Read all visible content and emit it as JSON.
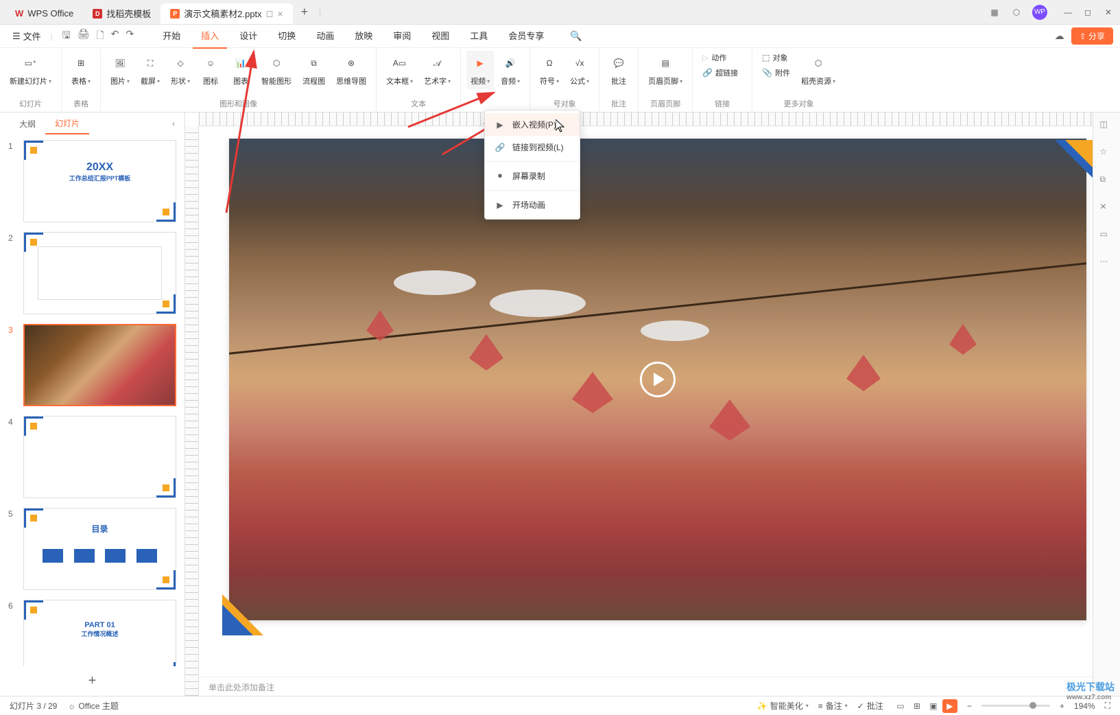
{
  "titlebar": {
    "app_name": "WPS Office",
    "tabs": [
      {
        "icon": "D",
        "label": "找稻壳模板"
      },
      {
        "icon": "P",
        "label": "演示文稿素材2.pptx"
      }
    ]
  },
  "menubar": {
    "file_label": "文件",
    "tabs": [
      "开始",
      "插入",
      "设计",
      "切换",
      "动画",
      "放映",
      "审阅",
      "视图",
      "工具",
      "会员专享"
    ],
    "active_tab": "插入",
    "share_label": "分享"
  },
  "ribbon": {
    "groups": [
      {
        "label": "幻灯片",
        "items": [
          {
            "label": "新建幻灯片",
            "caret": true
          }
        ]
      },
      {
        "label": "表格",
        "items": [
          {
            "label": "表格",
            "caret": true
          }
        ]
      },
      {
        "label": "图形和图像",
        "items": [
          {
            "label": "图片",
            "caret": true
          },
          {
            "label": "截屏",
            "caret": true
          },
          {
            "label": "形状",
            "caret": true
          },
          {
            "label": "图标"
          },
          {
            "label": "图表"
          },
          {
            "label": "智能图形"
          },
          {
            "label": "流程图"
          },
          {
            "label": "思维导图"
          }
        ]
      },
      {
        "label": "文本",
        "items": [
          {
            "label": "文本框",
            "caret": true
          },
          {
            "label": "艺术字",
            "caret": true
          }
        ]
      },
      {
        "label": "",
        "items": [
          {
            "label": "视频",
            "caret": true
          },
          {
            "label": "音频",
            "caret": true
          }
        ]
      },
      {
        "label": "号对象",
        "items": [
          {
            "label": "符号",
            "caret": true,
            "disabled": true
          },
          {
            "label": "公式",
            "caret": true
          }
        ]
      },
      {
        "label": "批注",
        "items": [
          {
            "label": "批注"
          }
        ]
      },
      {
        "label": "页眉页脚",
        "items": [
          {
            "label": "页眉页脚",
            "caret": true
          }
        ]
      },
      {
        "label": "链接",
        "items": [
          {
            "label": "动作",
            "disabled": true
          },
          {
            "label": "超链接",
            "disabled": true
          }
        ]
      },
      {
        "label": "更多对象",
        "items": [
          {
            "label": "对象"
          },
          {
            "label": "附件"
          },
          {
            "label": "稻壳资源",
            "caret": true
          }
        ]
      }
    ]
  },
  "slide_panel": {
    "outline_tab": "大纲",
    "slides_tab": "幻灯片",
    "slides": [
      {
        "num": "1",
        "type": "title",
        "year": "20XX",
        "subtitle": "工作总结汇报PPT模板"
      },
      {
        "num": "2",
        "type": "tree"
      },
      {
        "num": "3",
        "type": "image",
        "active": true
      },
      {
        "num": "4",
        "type": "blank"
      },
      {
        "num": "5",
        "type": "toc",
        "title": "目录"
      },
      {
        "num": "6",
        "type": "part",
        "title": "PART 01",
        "subtitle": "工作情况概述"
      }
    ]
  },
  "dropdown": {
    "items": [
      {
        "icon": "embed",
        "label": "嵌入视频(P)",
        "highlight": true
      },
      {
        "icon": "link",
        "label": "链接到视频(L)"
      },
      {
        "icon": "record",
        "label": "屏幕录制",
        "divider_before": true
      },
      {
        "icon": "anim",
        "label": "开场动画",
        "divider_before": true
      }
    ]
  },
  "notes": {
    "placeholder": "单击此处添加备注"
  },
  "statusbar": {
    "slide_info": "幻灯片 3 / 29",
    "theme": "Office 主题",
    "beautify": "智能美化",
    "notes": "备注",
    "comments": "批注",
    "zoom": "194%"
  },
  "watermark": {
    "main": "极光下载站",
    "sub": "www.xz7.com"
  }
}
